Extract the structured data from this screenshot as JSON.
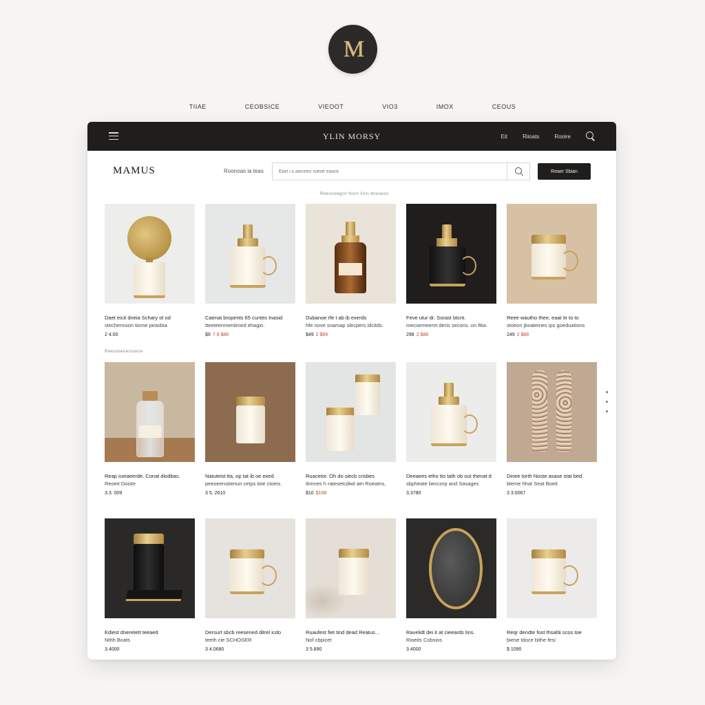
{
  "logo": {
    "monogram": "M"
  },
  "top_nav": [
    "TIIAE",
    "CEOBSICE",
    "VIEOOT",
    "VIO3",
    "IMOX",
    "CEOUS"
  ],
  "window": {
    "title": "YLIN MORSY",
    "toolbar_links": [
      "Eit",
      "Riioats",
      "Rooire"
    ]
  },
  "header": {
    "brand": "MAMUS",
    "search_label": "Roonoas ia teas",
    "search_placeholder": "Eiiel i.s.iiiecees isieiie eaiice",
    "cta_label": "Reaer Sbian"
  },
  "sections": {
    "featured_label": "Reescoegcn hiicn iiicn dnesess",
    "secondary_label": "Reeumeirerscece"
  },
  "products": [
    {
      "name": "Daet eicit dneia Schary ot od",
      "desc": "stechemsion tiome peasbia",
      "price": "2 4.00",
      "sale": "",
      "bg": "#ededeb",
      "style": "disc"
    },
    {
      "name": "Caenat bropents 65 cuntes tnasid",
      "desc": "tteeteenmeniimed ehagio.",
      "price": "$9",
      "sale": "7.9 $88",
      "bg": "#e6e8e8",
      "style": "cup"
    },
    {
      "name": "Dubanoe rfe t ab ib exerds",
      "desc": "hfe nove snamap slecpers idcitds.",
      "price": "$49",
      "sale": "2 $89",
      "bg": "#e9e3d9",
      "style": "amber"
    },
    {
      "name": "Feve utur dr. Sorast btcnt.",
      "desc": "mecsemeeret deris secons. on fitia.",
      "price": "298",
      "sale": "2 $88",
      "bg": "#1f1e1d",
      "style": "darkcup"
    },
    {
      "name": "Reee wautho thee, eaat itr to to",
      "desc": "stoeon jboateines ips goeduations",
      "price": "249",
      "sale": "2 $88",
      "bg": "#d7c1a4",
      "style": "cup2"
    },
    {
      "name": "Reap iueiaeerde. Conat diodbas.",
      "desc": "Reoeit Doiste",
      "price": "3.3. 009",
      "sale": "",
      "bg": "#c9b8a0",
      "style": "glass"
    },
    {
      "name": "Natuteist tta, op tat ib oe exed",
      "desc": "peeoeenstieriun cetps toie ctoeis.",
      "price": "3 5. 2610",
      "sale": "",
      "bg": "#8c6b4f",
      "style": "jar"
    },
    {
      "name": "Ruacetor. Oh do siecb crisbes",
      "desc": "itimnes h ratesetcdiwl atn Roeatns,",
      "price": "$10",
      "sale": "$168",
      "bg": "#e3e4e4",
      "style": "twojars"
    },
    {
      "name": "Deeaees etho tto tath ob out thenat d",
      "desc": "sbpheate beccorp and Sasages",
      "price": "3.3780",
      "sale": "",
      "bg": "#ececea",
      "style": "cup3"
    },
    {
      "name": "Dinee torth Noste asase stat bed.",
      "desc": "bleme hhat Seat Boeit",
      "price": "3 3.0067",
      "sale": "",
      "bg": "#bfa992",
      "style": "tubes"
    },
    {
      "name": "Ediest dneretett teeaed",
      "desc": "Nthh Boats",
      "price": "3.4000",
      "sale": "",
      "bg": "#2a2928",
      "style": "darkjar"
    },
    {
      "name": "Dersurt sbcb reesened ditrel icdo",
      "desc": "teeth cie SCHOSER",
      "price": "3 4.0680",
      "sale": "",
      "bg": "#e6e3de",
      "style": "mug"
    },
    {
      "name": "Ruaufest fiet tind dead Reatus...",
      "desc": "Nof cbpicet",
      "price": "3 5.890",
      "sale": "",
      "bg": "#e4ded6",
      "style": "jar2"
    },
    {
      "name": "Ravelidt dei it at cieeards tins.",
      "desc": "Rioeits Cobsios",
      "price": "3.4000",
      "sale": "",
      "bg": "#2b2a29",
      "style": "mirror"
    },
    {
      "name": "Reqr dendte fost thsaltii scos toe",
      "desc": "biene tdoce bithe fesi",
      "price": "$ 1090",
      "sale": "",
      "bg": "#ecebea",
      "style": "mug2"
    }
  ],
  "colors": {
    "accent_gold": "#c9a25a",
    "dark": "#1f1e1d",
    "sale_red": "#c24a2c"
  }
}
